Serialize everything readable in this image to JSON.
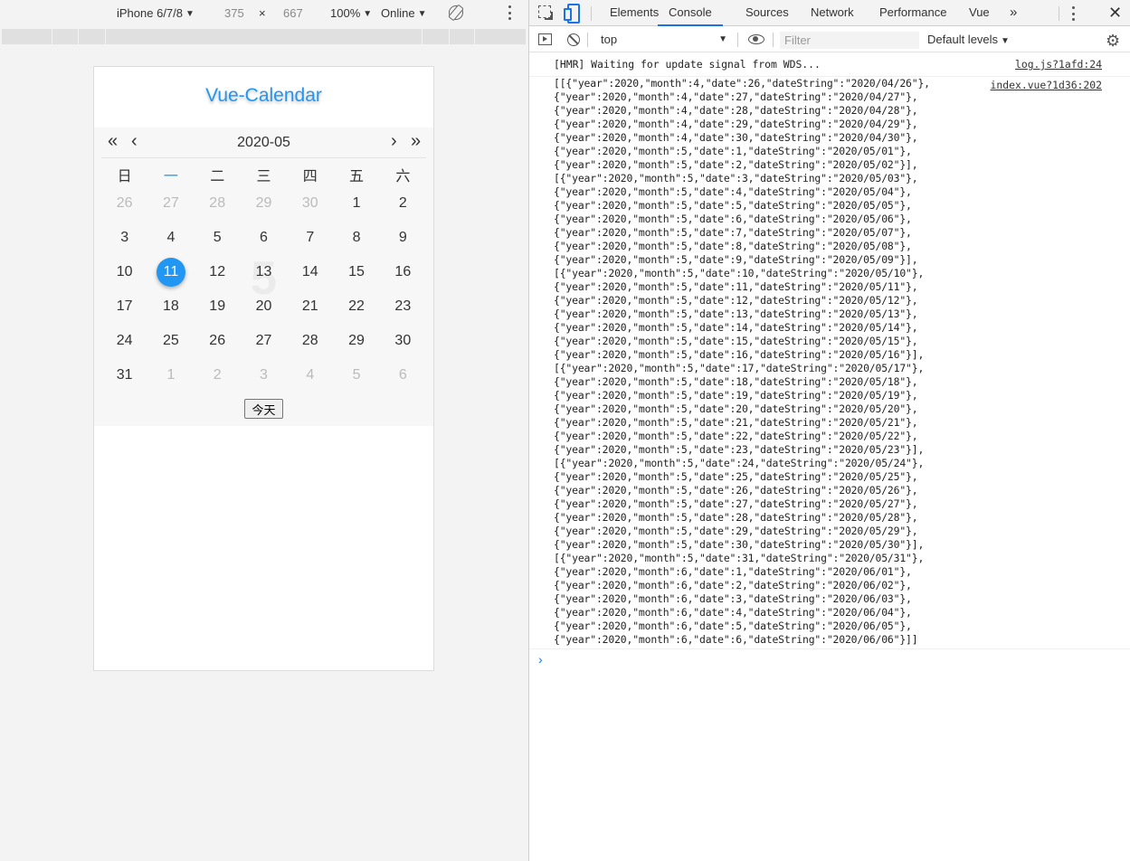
{
  "device_toolbar": {
    "device": "iPhone 6/7/8",
    "width": "375",
    "times": "×",
    "height": "667",
    "zoom": "100%",
    "network": "Online"
  },
  "calendar": {
    "title": "Vue-Calendar",
    "month_label": "2020-05",
    "bg_month": "5",
    "nav": {
      "prev_year": "«",
      "prev_month": "‹",
      "next_month": "›",
      "next_year": "»"
    },
    "weekdays": [
      "日",
      "一",
      "二",
      "三",
      "四",
      "五",
      "六"
    ],
    "weeks": [
      [
        {
          "d": "26",
          "o": true
        },
        {
          "d": "27",
          "o": true
        },
        {
          "d": "28",
          "o": true
        },
        {
          "d": "29",
          "o": true
        },
        {
          "d": "30",
          "o": true
        },
        {
          "d": "1",
          "o": false
        },
        {
          "d": "2",
          "o": false
        }
      ],
      [
        {
          "d": "3",
          "o": false
        },
        {
          "d": "4",
          "o": false
        },
        {
          "d": "5",
          "o": false
        },
        {
          "d": "6",
          "o": false
        },
        {
          "d": "7",
          "o": false
        },
        {
          "d": "8",
          "o": false
        },
        {
          "d": "9",
          "o": false
        }
      ],
      [
        {
          "d": "10",
          "o": false
        },
        {
          "d": "11",
          "o": false,
          "today": true
        },
        {
          "d": "12",
          "o": false
        },
        {
          "d": "13",
          "o": false
        },
        {
          "d": "14",
          "o": false
        },
        {
          "d": "15",
          "o": false
        },
        {
          "d": "16",
          "o": false
        }
      ],
      [
        {
          "d": "17",
          "o": false
        },
        {
          "d": "18",
          "o": false
        },
        {
          "d": "19",
          "o": false
        },
        {
          "d": "20",
          "o": false
        },
        {
          "d": "21",
          "o": false
        },
        {
          "d": "22",
          "o": false
        },
        {
          "d": "23",
          "o": false
        }
      ],
      [
        {
          "d": "24",
          "o": false
        },
        {
          "d": "25",
          "o": false
        },
        {
          "d": "26",
          "o": false
        },
        {
          "d": "27",
          "o": false
        },
        {
          "d": "28",
          "o": false
        },
        {
          "d": "29",
          "o": false
        },
        {
          "d": "30",
          "o": false
        }
      ],
      [
        {
          "d": "31",
          "o": false
        },
        {
          "d": "1",
          "o": true
        },
        {
          "d": "2",
          "o": true
        },
        {
          "d": "3",
          "o": true
        },
        {
          "d": "4",
          "o": true
        },
        {
          "d": "5",
          "o": true
        },
        {
          "d": "6",
          "o": true
        }
      ]
    ],
    "today_button": "今天",
    "accent_color": "#2196f3"
  },
  "devtools": {
    "tabs": [
      "Elements",
      "Console",
      "Sources",
      "Network",
      "Performance",
      "Vue"
    ],
    "active_tab": "Console",
    "more_tabs": "»",
    "close": "✕",
    "context": "top",
    "filter_placeholder": "Filter",
    "levels": "Default levels"
  },
  "console": {
    "hmr_text": "[HMR] Waiting for update signal from WDS...",
    "hmr_source": "log.js?1afd:24",
    "log_source": "index.vue?1d36:202",
    "log_lines": [
      "[[{\"year\":2020,\"month\":4,\"date\":26,\"dateString\":\"2020/04/26\"},",
      "{\"year\":2020,\"month\":4,\"date\":27,\"dateString\":\"2020/04/27\"},",
      "{\"year\":2020,\"month\":4,\"date\":28,\"dateString\":\"2020/04/28\"},",
      "{\"year\":2020,\"month\":4,\"date\":29,\"dateString\":\"2020/04/29\"},",
      "{\"year\":2020,\"month\":4,\"date\":30,\"dateString\":\"2020/04/30\"},",
      "{\"year\":2020,\"month\":5,\"date\":1,\"dateString\":\"2020/05/01\"},",
      "{\"year\":2020,\"month\":5,\"date\":2,\"dateString\":\"2020/05/02\"}],",
      "[{\"year\":2020,\"month\":5,\"date\":3,\"dateString\":\"2020/05/03\"},",
      "{\"year\":2020,\"month\":5,\"date\":4,\"dateString\":\"2020/05/04\"},",
      "{\"year\":2020,\"month\":5,\"date\":5,\"dateString\":\"2020/05/05\"},",
      "{\"year\":2020,\"month\":5,\"date\":6,\"dateString\":\"2020/05/06\"},",
      "{\"year\":2020,\"month\":5,\"date\":7,\"dateString\":\"2020/05/07\"},",
      "{\"year\":2020,\"month\":5,\"date\":8,\"dateString\":\"2020/05/08\"},",
      "{\"year\":2020,\"month\":5,\"date\":9,\"dateString\":\"2020/05/09\"}],",
      "[{\"year\":2020,\"month\":5,\"date\":10,\"dateString\":\"2020/05/10\"},",
      "{\"year\":2020,\"month\":5,\"date\":11,\"dateString\":\"2020/05/11\"},",
      "{\"year\":2020,\"month\":5,\"date\":12,\"dateString\":\"2020/05/12\"},",
      "{\"year\":2020,\"month\":5,\"date\":13,\"dateString\":\"2020/05/13\"},",
      "{\"year\":2020,\"month\":5,\"date\":14,\"dateString\":\"2020/05/14\"},",
      "{\"year\":2020,\"month\":5,\"date\":15,\"dateString\":\"2020/05/15\"},",
      "{\"year\":2020,\"month\":5,\"date\":16,\"dateString\":\"2020/05/16\"}],",
      "[{\"year\":2020,\"month\":5,\"date\":17,\"dateString\":\"2020/05/17\"},",
      "{\"year\":2020,\"month\":5,\"date\":18,\"dateString\":\"2020/05/18\"},",
      "{\"year\":2020,\"month\":5,\"date\":19,\"dateString\":\"2020/05/19\"},",
      "{\"year\":2020,\"month\":5,\"date\":20,\"dateString\":\"2020/05/20\"},",
      "{\"year\":2020,\"month\":5,\"date\":21,\"dateString\":\"2020/05/21\"},",
      "{\"year\":2020,\"month\":5,\"date\":22,\"dateString\":\"2020/05/22\"},",
      "{\"year\":2020,\"month\":5,\"date\":23,\"dateString\":\"2020/05/23\"}],",
      "[{\"year\":2020,\"month\":5,\"date\":24,\"dateString\":\"2020/05/24\"},",
      "{\"year\":2020,\"month\":5,\"date\":25,\"dateString\":\"2020/05/25\"},",
      "{\"year\":2020,\"month\":5,\"date\":26,\"dateString\":\"2020/05/26\"},",
      "{\"year\":2020,\"month\":5,\"date\":27,\"dateString\":\"2020/05/27\"},",
      "{\"year\":2020,\"month\":5,\"date\":28,\"dateString\":\"2020/05/28\"},",
      "{\"year\":2020,\"month\":5,\"date\":29,\"dateString\":\"2020/05/29\"},",
      "{\"year\":2020,\"month\":5,\"date\":30,\"dateString\":\"2020/05/30\"}],",
      "[{\"year\":2020,\"month\":5,\"date\":31,\"dateString\":\"2020/05/31\"},",
      "{\"year\":2020,\"month\":6,\"date\":1,\"dateString\":\"2020/06/01\"},",
      "{\"year\":2020,\"month\":6,\"date\":2,\"dateString\":\"2020/06/02\"},",
      "{\"year\":2020,\"month\":6,\"date\":3,\"dateString\":\"2020/06/03\"},",
      "{\"year\":2020,\"month\":6,\"date\":4,\"dateString\":\"2020/06/04\"},",
      "{\"year\":2020,\"month\":6,\"date\":5,\"dateString\":\"2020/06/05\"},",
      "{\"year\":2020,\"month\":6,\"date\":6,\"dateString\":\"2020/06/06\"}]]"
    ],
    "prompt": "›"
  }
}
